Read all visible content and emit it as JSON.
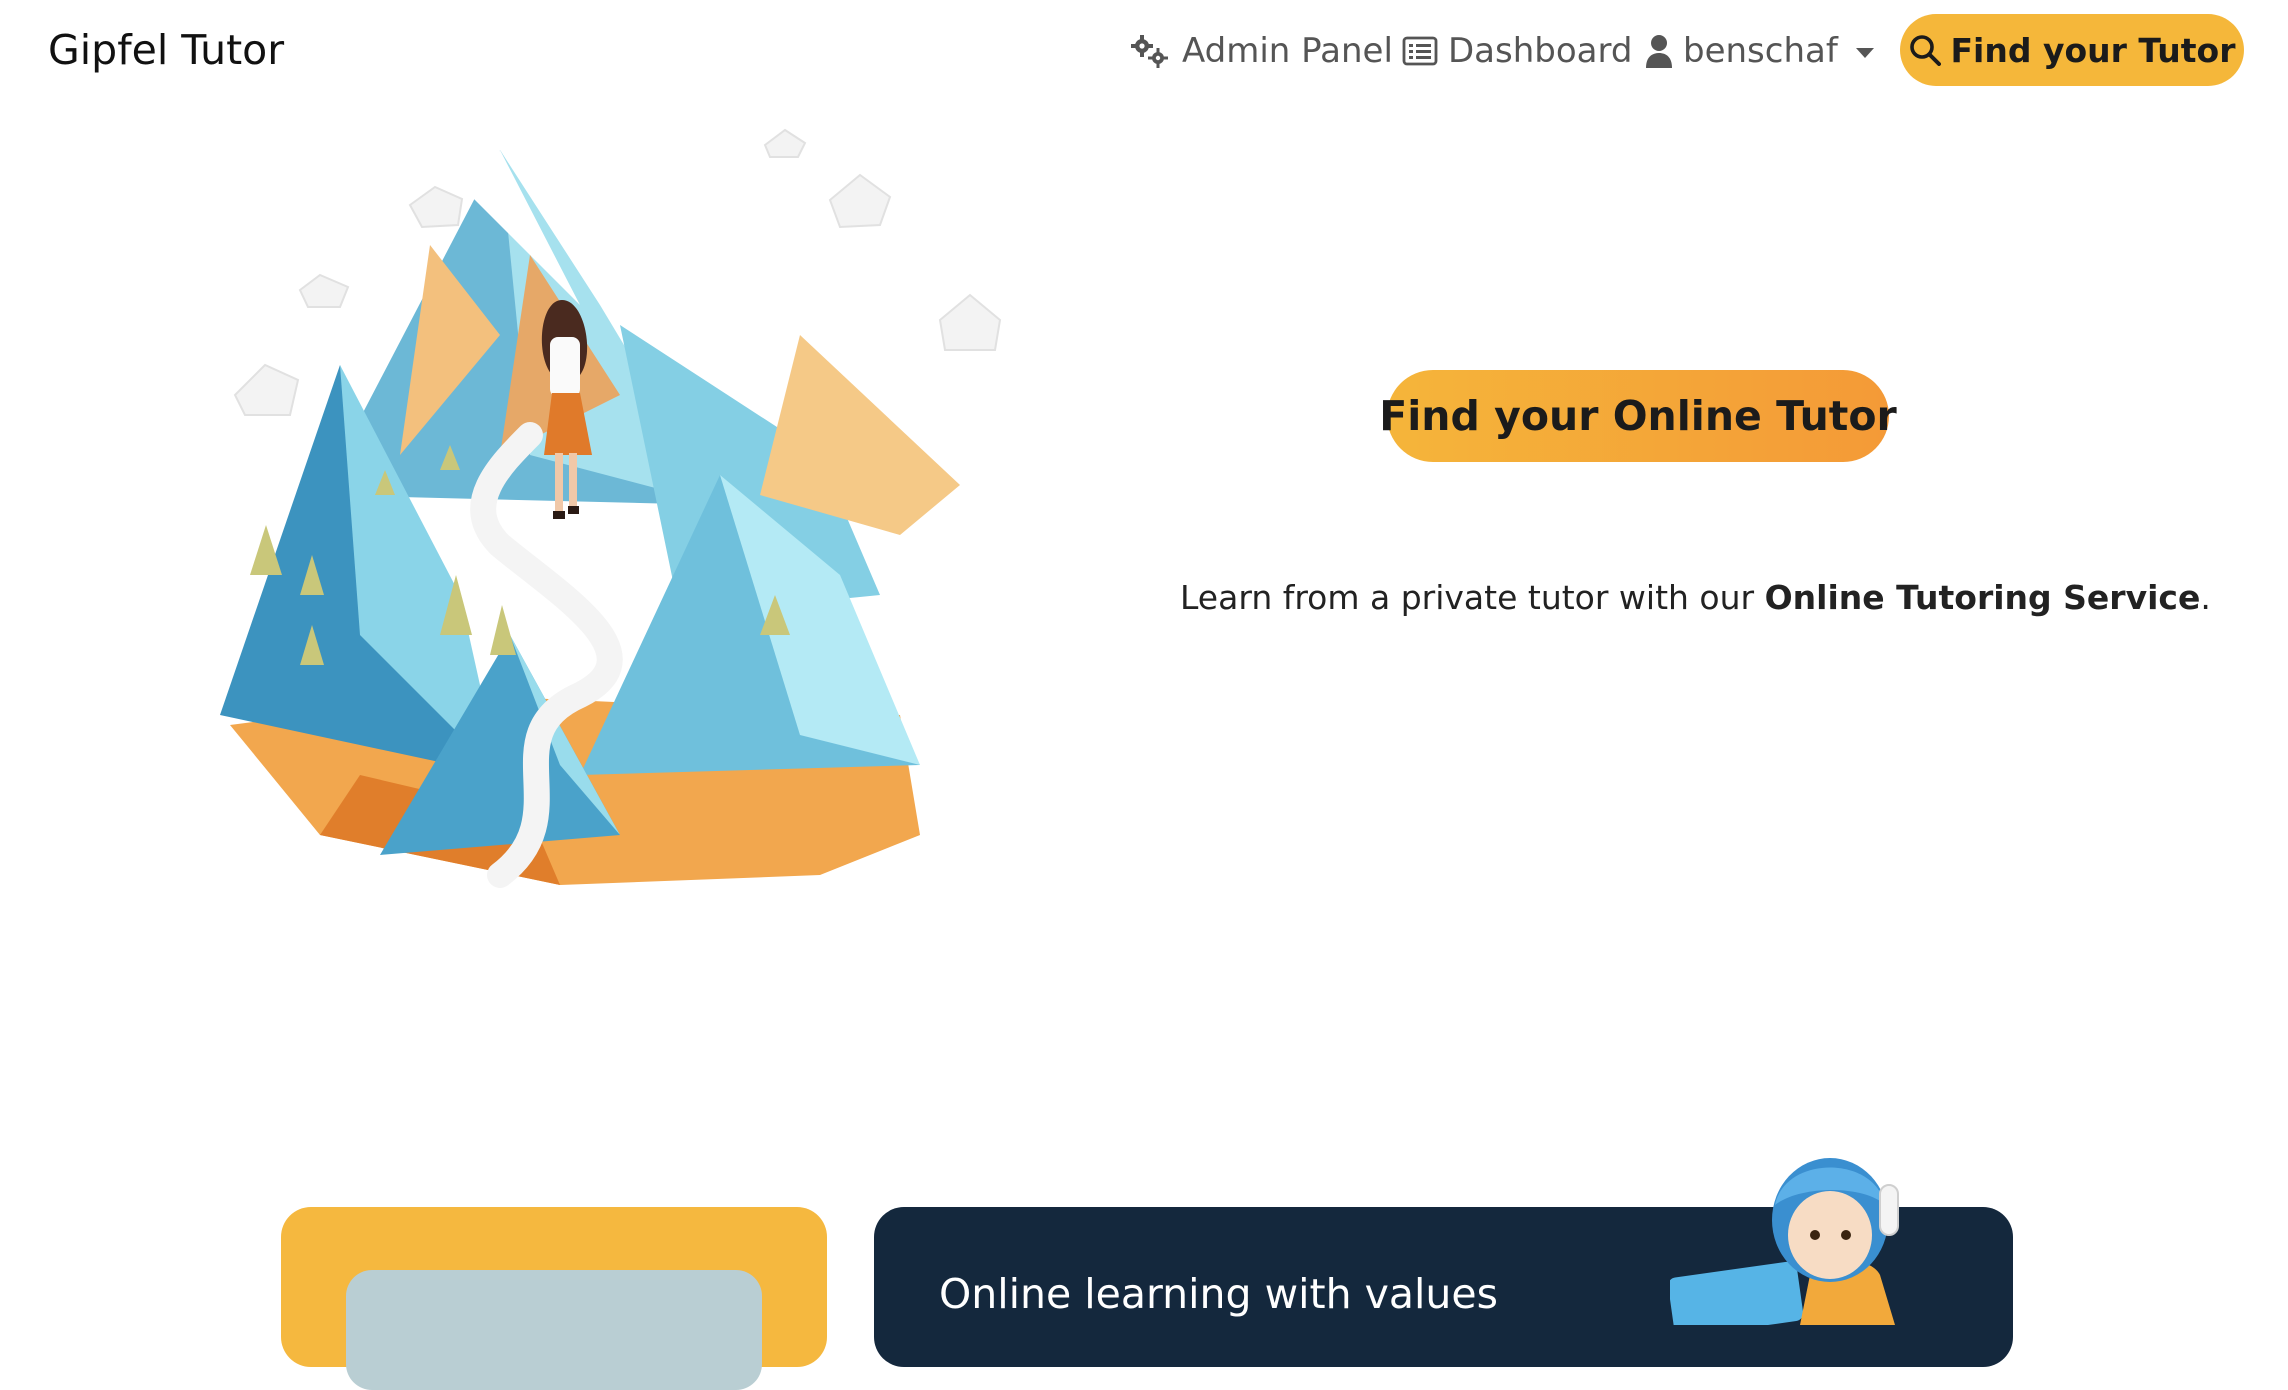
{
  "brand": "Gipfel Tutor",
  "nav": {
    "admin": {
      "label": "Admin Panel",
      "icon": "gears-icon"
    },
    "dashboard": {
      "label": "Dashboard",
      "icon": "list-icon"
    },
    "user": {
      "label": "benschaf",
      "icon": "user-icon"
    },
    "find": {
      "label": "Find your Tutor",
      "icon": "search-icon"
    }
  },
  "hero": {
    "cta": "Find your Online Tutor",
    "lead_prefix": "Learn from a private tutor with our ",
    "lead_bold": "Online Tutoring Service",
    "lead_suffix": "."
  },
  "cards": {
    "values_title": "Online learning with values"
  },
  "colors": {
    "accent": "#f5b73a",
    "accent_end": "#f49a37",
    "dark_card": "#14283d",
    "nav_text": "#555555"
  }
}
